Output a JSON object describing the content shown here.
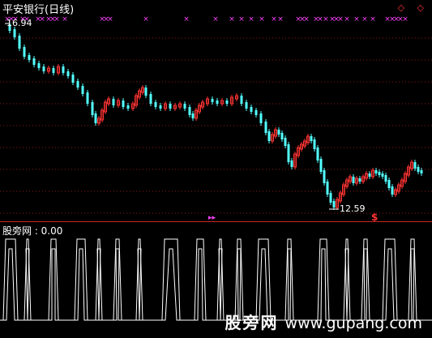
{
  "window": {
    "title": "平安银行(日线)",
    "control_glyphs": "◇ ◇"
  },
  "main_chart": {
    "high_label": "16.94",
    "low_label": "12.59",
    "marker_glyph": "$"
  },
  "indicator": {
    "title": "股旁网 : 0.00"
  },
  "watermark": {
    "cn": "股旁网",
    "url": "www.gupang.com"
  },
  "colors": {
    "background": "#000000",
    "grid_line": "#8b1a1a",
    "separator": "#cc2222",
    "up_candle": "#ff3333",
    "down_candle": "#54ffff",
    "signal_mark": "#ff44ff",
    "indicator_line": "#ffffff"
  }
}
